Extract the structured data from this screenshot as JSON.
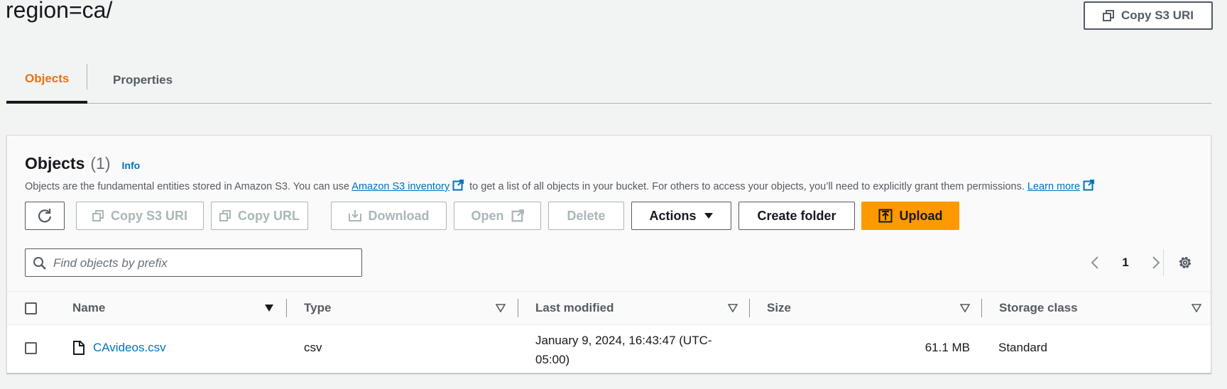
{
  "page": {
    "title": "region=ca/",
    "copy_s3_uri_label": "Copy S3 URI"
  },
  "tabs": [
    {
      "label": "Objects",
      "active": true
    },
    {
      "label": "Properties",
      "active": false
    }
  ],
  "objects_panel": {
    "title": "Objects",
    "count": "(1)",
    "info_label": "Info",
    "description": {
      "prefix": "Objects are the fundamental entities stored in Amazon S3. You can use ",
      "inventory_link": "Amazon S3 inventory",
      "middle": " to get a list of all objects in your bucket. For others to access your objects, you’ll need to explicitly grant them permissions. ",
      "learn_more_link": "Learn more"
    },
    "toolbar": {
      "refresh_icon": "refresh-icon",
      "copy_s3_uri": "Copy S3 URI",
      "copy_url": "Copy URL",
      "download": "Download",
      "open": "Open",
      "delete": "Delete",
      "actions": "Actions",
      "create_folder": "Create folder",
      "upload": "Upload"
    },
    "search": {
      "placeholder": "Find objects by prefix",
      "value": ""
    },
    "pagination": {
      "current_page": "1"
    },
    "table": {
      "columns": [
        "Name",
        "Type",
        "Last modified",
        "Size",
        "Storage class"
      ],
      "rows": [
        {
          "name": "CAvideos.csv",
          "type": "csv",
          "last_modified_line1": "January 9, 2024, 16:43:47 (UTC-",
          "last_modified_line2": "05:00)",
          "size": "61.1 MB",
          "storage_class": "Standard"
        }
      ]
    }
  },
  "colors": {
    "accent_orange": "#ec7211",
    "primary_button": "#ff9900",
    "link_blue": "#0073bb",
    "disabled_text": "#aab7b8"
  }
}
